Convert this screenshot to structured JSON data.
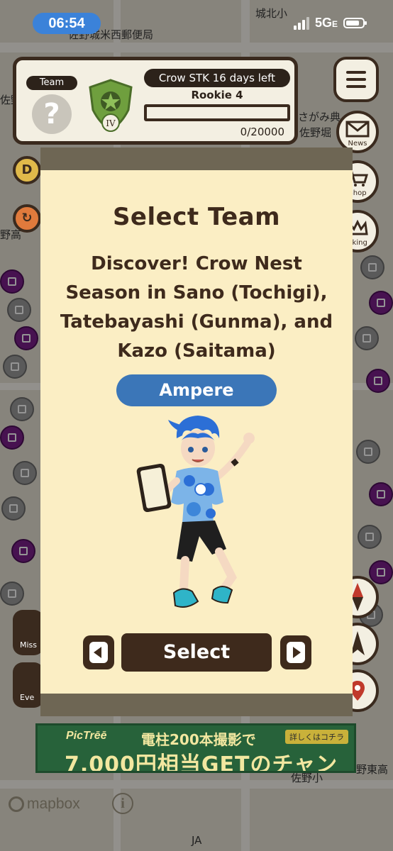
{
  "status_bar": {
    "time": "06:54",
    "network": "5G",
    "network_suffix": "E"
  },
  "hud": {
    "team_label": "Team",
    "team_placeholder": "?",
    "rank_numeral": "IV",
    "event_banner": "Crow STK 16 days left",
    "rank_name": "Rookie 4",
    "progress_text": "0/20000",
    "progress_fraction": 0
  },
  "side_menu": {
    "news": "News",
    "shop": "Shop",
    "ranking": "nking"
  },
  "left_controls": {
    "d_button": "D",
    "missions": "Miss",
    "events": "Eve"
  },
  "map_labels": {
    "label1": "城北小",
    "label2": "佐野城米西郵便局",
    "label3": "佐野堀",
    "label4": "さがみ典",
    "label5": "佐野小",
    "label6": "野東高",
    "label7": "JA",
    "label8": "野高",
    "label9": "佐野"
  },
  "modal": {
    "title": "Select Team",
    "description": "Discover! Crow Nest Season in Sano (Tochigi), Tatebayashi (Gunma), and Kazo (Saitama)",
    "team_name": "Ampere",
    "select_label": "Select"
  },
  "ad": {
    "brand": "PicTrēē",
    "line1": "電柱200本撮影で",
    "line2": "7,000円相当GETのチャンス!",
    "tag": "詳しくはコチラ"
  },
  "footer": {
    "mapbox": "mapbox",
    "info": "i"
  },
  "colors": {
    "modal_bg": "#fbeec4",
    "brown": "#3e2a1c",
    "team_blue": "#3b76b8",
    "time_pill": "#3b82d9"
  }
}
